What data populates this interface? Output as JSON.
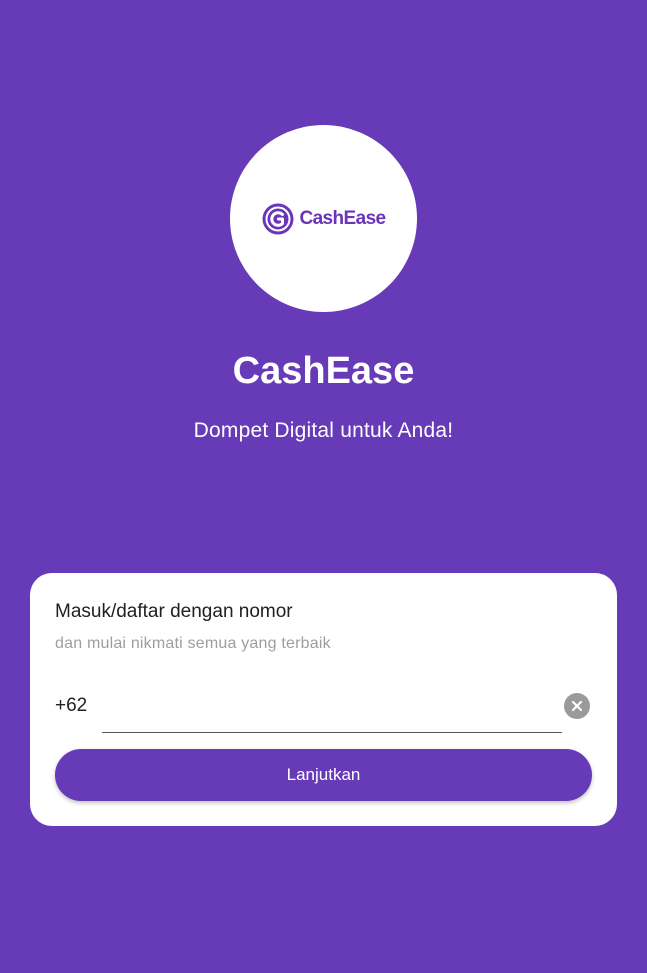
{
  "logo": {
    "text": "CashEase",
    "icon": "cashease-coin-logo-icon",
    "color": "#6a35b8"
  },
  "header": {
    "title": "CashEase",
    "tagline": "Dompet Digital untuk Anda!"
  },
  "login_card": {
    "heading": "Masuk/daftar dengan nomor",
    "subheading": "dan mulai nikmati semua yang terbaik",
    "country_code": "+62",
    "phone_value": "",
    "phone_placeholder": "",
    "clear_icon": "clear-circle-icon",
    "continue_label": "Lanjutkan"
  },
  "colors": {
    "background": "#673ab7",
    "card": "#ffffff",
    "button": "#673ab7",
    "muted_text": "#9e9e9e"
  }
}
